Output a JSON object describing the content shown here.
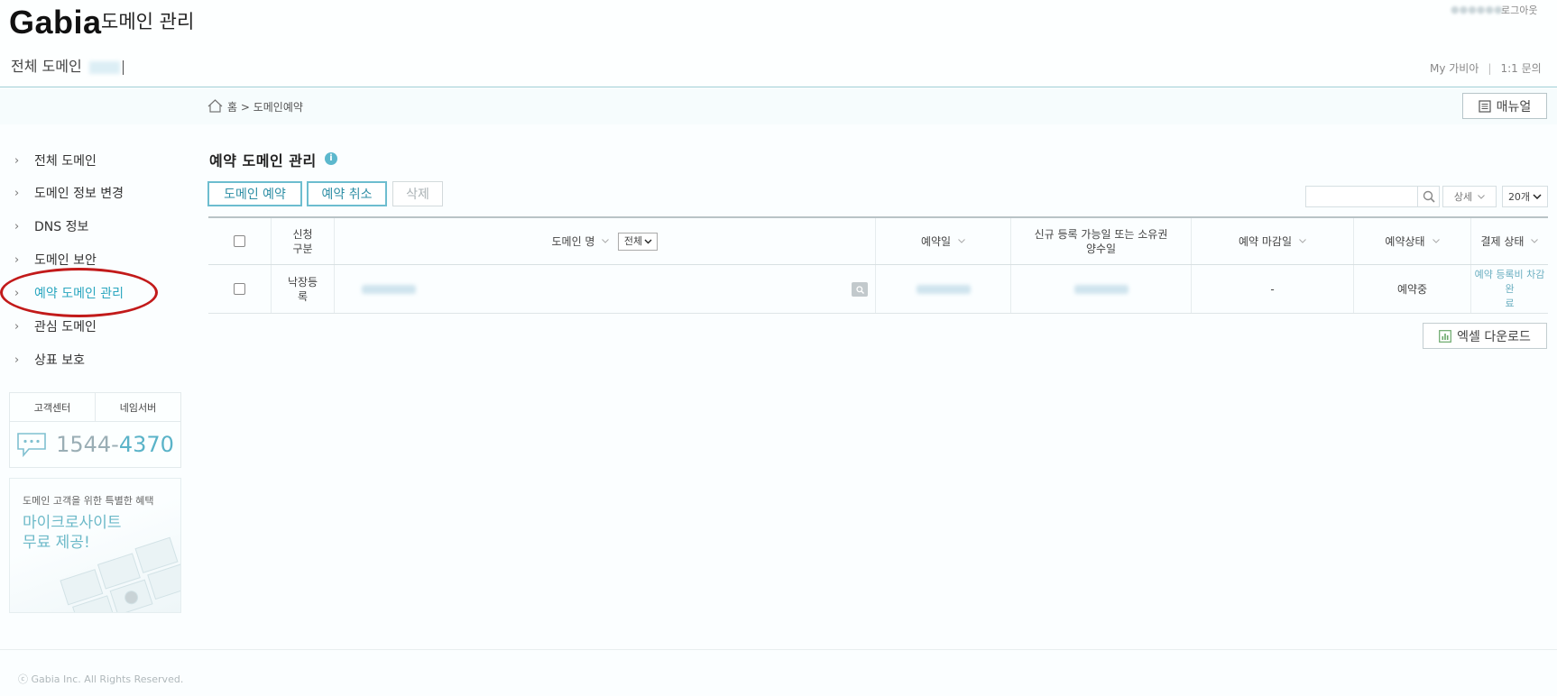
{
  "header": {
    "logo": "Gabia",
    "app_title": "도메인 관리",
    "logout_label": "로그아웃",
    "user_name": "",
    "domain_select_label": "전체 도메인",
    "links": [
      "My 가비아",
      "1:1 문의"
    ],
    "link_separator": "|"
  },
  "breadcrumb": {
    "text": "홈 > 도메인예약"
  },
  "manual_button": {
    "label": "매뉴얼"
  },
  "sidebar": {
    "items": [
      {
        "label": "전체 도메인",
        "active": false
      },
      {
        "label": "도메인 정보 변경",
        "active": false
      },
      {
        "label": "DNS 정보",
        "active": false
      },
      {
        "label": "도메인 보안",
        "active": false
      },
      {
        "label": "예약 도메인 관리",
        "active": true
      },
      {
        "label": "관심 도메인",
        "active": false
      },
      {
        "label": "상표 보호",
        "active": false
      }
    ],
    "chevron": "›",
    "customer_center": {
      "tabs": [
        "고객센터",
        "네임서버"
      ],
      "phone_prefix": "1544-",
      "phone_suffix": "4370"
    },
    "promo": {
      "line1": "도메인 고객을 위한 특별한 혜택",
      "line2": "마이크로사이트",
      "line3": "무료 제공!"
    }
  },
  "main": {
    "title": "예약 도메인 관리",
    "info_icon": "i",
    "buttons": {
      "reserve": "도메인 예약",
      "cancel": "예약 취소",
      "delete": "삭제"
    },
    "search": {
      "placeholder": "",
      "detail_label": "상세",
      "count_label": "20개"
    },
    "table": {
      "headers": {
        "type": "신청\n구분",
        "domain": "도메인 명",
        "domain_filter": "전체",
        "reserve_date": "예약일",
        "available_date": "신규 등록 가능일 또는 소유권\n양수일",
        "deadline": "예약 마감일",
        "status": "예약상태",
        "payment": "결제 상태"
      },
      "rows": [
        {
          "type": "낙장등\n록",
          "domain": "",
          "reserve_date": "",
          "available_date": "",
          "deadline": "-",
          "status": "예약중",
          "payment": "예약 등록비 차감 완\n료"
        }
      ]
    },
    "excel_button": "엑셀 다운로드"
  },
  "footer": {
    "copyright": "ⓒ Gabia Inc. All Rights Reserved."
  },
  "colors": {
    "accent": "#2aa6bf",
    "highlight_circle": "#c21a1a",
    "header_border": "#9fcfd6"
  }
}
